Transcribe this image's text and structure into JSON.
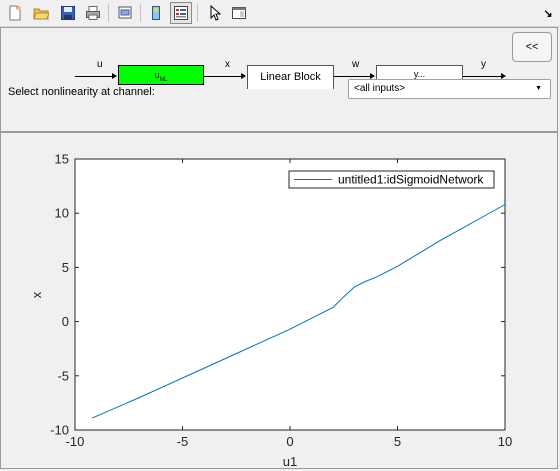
{
  "toolbar": {
    "icons": [
      "new-file-icon",
      "open-folder-icon",
      "save-icon",
      "print-icon",
      "print-preview-icon",
      "data-tip-icon",
      "property-editor-icon",
      "pointer-icon",
      "dock-icon"
    ],
    "undock_glyph": "↘"
  },
  "diagram": {
    "collapse_label": "<<",
    "signals": {
      "u": "u",
      "x": "x",
      "w": "w",
      "y": "y"
    },
    "nonlinear_block_label": "u",
    "nonlinear_block_subscript": "NL",
    "linear_block_label": "Linear Block",
    "output_block_label": "y...",
    "select_label": "Select nonlinearity at channel:",
    "select_value": "<all inputs>",
    "nonlinear_block_color": "#00ff00"
  },
  "chart_data": {
    "type": "line",
    "xlabel": "u1",
    "ylabel": "x",
    "xlim": [
      -10,
      10
    ],
    "ylim": [
      -10,
      15
    ],
    "xticks": [
      -10,
      -5,
      0,
      5,
      10
    ],
    "yticks": [
      -10,
      -5,
      0,
      5,
      10,
      15
    ],
    "grid": false,
    "legend_position": "top-right",
    "series": [
      {
        "name": "untitled1:idSigmoidNetwork",
        "color": "#0072bd",
        "x": [
          -9.2,
          -7,
          -5,
          -3,
          -1,
          0,
          1,
          2,
          2.5,
          3,
          3.5,
          4,
          5,
          6,
          7,
          8,
          9,
          10
        ],
        "y": [
          -8.9,
          -7.0,
          -5.2,
          -3.4,
          -1.6,
          -0.7,
          0.3,
          1.3,
          2.3,
          3.2,
          3.7,
          4.1,
          5.1,
          6.3,
          7.5,
          8.6,
          9.7,
          10.8
        ]
      }
    ]
  }
}
